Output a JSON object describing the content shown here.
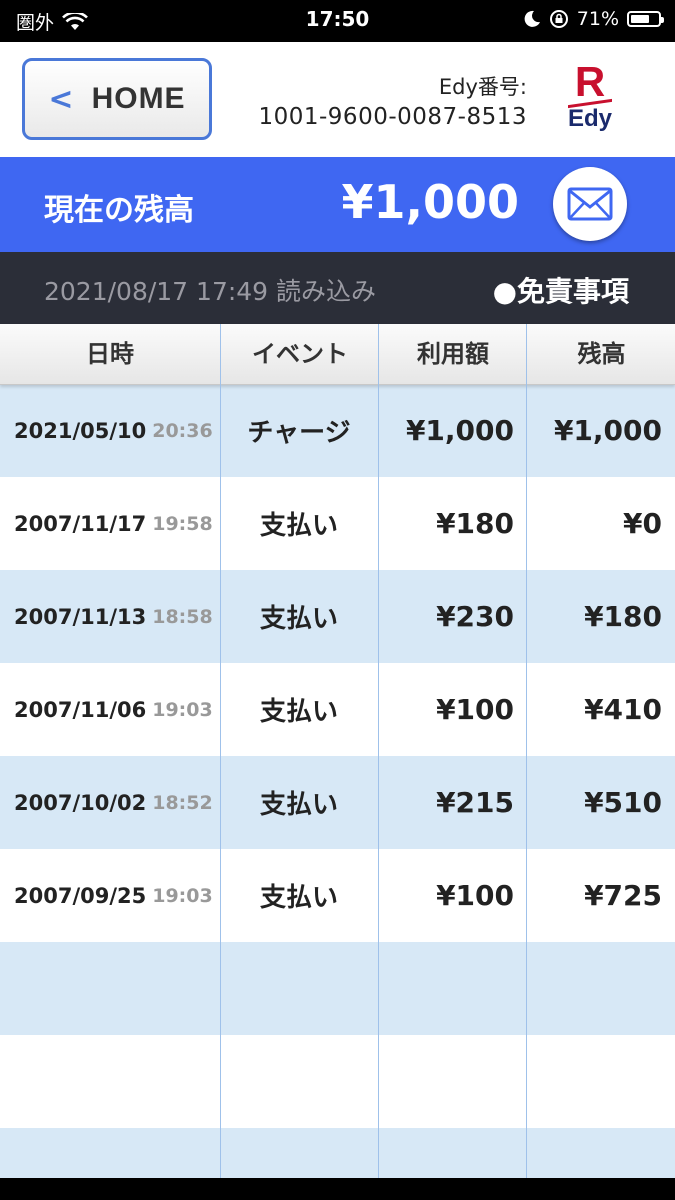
{
  "status_bar": {
    "carrier": "圏外",
    "time": "17:50",
    "battery_pct": "71%",
    "battery_level": 0.71
  },
  "header": {
    "home_label": "HOME",
    "edy_number_label": "Edy番号:",
    "edy_number": "1001-9600-0087-8513",
    "logo_r": "R",
    "logo_text": "Edy"
  },
  "balance": {
    "label": "現在の残高",
    "amount": "¥1,000"
  },
  "info": {
    "read_time": "2021/08/17 17:49 読み込み",
    "disclaimer": "●免責事項"
  },
  "table": {
    "headers": [
      "日時",
      "イベント",
      "利用額",
      "残高"
    ],
    "rows": [
      {
        "date": "2021/05/10",
        "time": "20:36",
        "event": "チャージ",
        "amount": "¥1,000",
        "balance": "¥1,000"
      },
      {
        "date": "2007/11/17",
        "time": "19:58",
        "event": "支払い",
        "amount": "¥180",
        "balance": "¥0"
      },
      {
        "date": "2007/11/13",
        "time": "18:58",
        "event": "支払い",
        "amount": "¥230",
        "balance": "¥180"
      },
      {
        "date": "2007/11/06",
        "time": "19:03",
        "event": "支払い",
        "amount": "¥100",
        "balance": "¥410"
      },
      {
        "date": "2007/10/02",
        "time": "18:52",
        "event": "支払い",
        "amount": "¥215",
        "balance": "¥510"
      },
      {
        "date": "2007/09/25",
        "time": "19:03",
        "event": "支払い",
        "amount": "¥100",
        "balance": "¥725"
      }
    ],
    "empty_rows": 3
  },
  "colors": {
    "accent_blue": "#3f67f2",
    "row_alt": "#d7e8f6",
    "info_bar": "#2b2e38",
    "rakuten_red": "#c8102e",
    "edy_navy": "#1a2a6c"
  }
}
